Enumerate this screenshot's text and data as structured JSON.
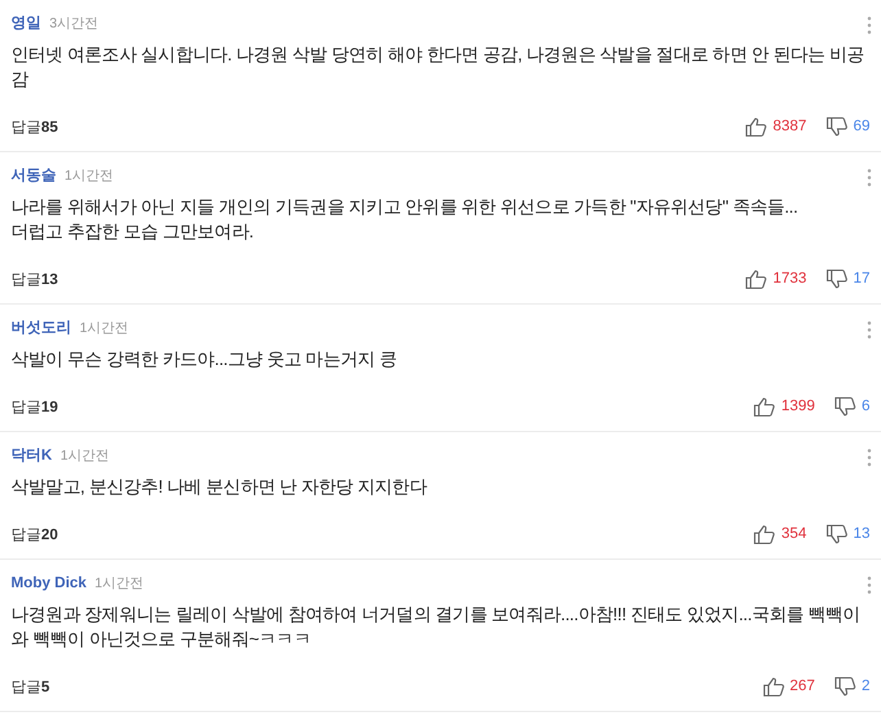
{
  "comments": [
    {
      "author": "영일",
      "time": "3시간전",
      "text": "인터넷 여론조사 실시합니다. 나경원 삭발 당연히 해야 한다면 공감, 나경원은 삭발을 절대로 하면 안 된다는 비공감",
      "reply_label": "답글",
      "reply_count": "85",
      "likes": "8387",
      "dislikes": "69"
    },
    {
      "author": "서동술",
      "time": "1시간전",
      "text": "나라를 위해서가 아닌 지들 개인의 기득권을 지키고 안위를 위한 위선으로 가득한 \"자유위선당\" 족속들...\n더럽고 추잡한 모습 그만보여라.",
      "reply_label": "답글",
      "reply_count": "13",
      "likes": "1733",
      "dislikes": "17"
    },
    {
      "author": "버섯도리",
      "time": "1시간전",
      "text": "삭발이 무슨 강력한 카드야...그냥 웃고 마는거지 킁",
      "reply_label": "답글",
      "reply_count": "19",
      "likes": "1399",
      "dislikes": "6"
    },
    {
      "author": "닥터K",
      "time": "1시간전",
      "text": "삭발말고, 분신강추! 나베 분신하면 난 자한당 지지한다",
      "reply_label": "답글",
      "reply_count": "20",
      "likes": "354",
      "dislikes": "13"
    },
    {
      "author": "Moby Dick",
      "time": "1시간전",
      "text": "나경원과 장제워니는 릴레이 삭발에 참여하여 너거덜의 결기를 보여줘라....아참!!! 진태도 있었지...국회를 빽빽이와 빽빽이 아닌것으로 구분해줘~ㅋㅋㅋ",
      "reply_label": "답글",
      "reply_count": "5",
      "likes": "267",
      "dislikes": "2"
    }
  ]
}
